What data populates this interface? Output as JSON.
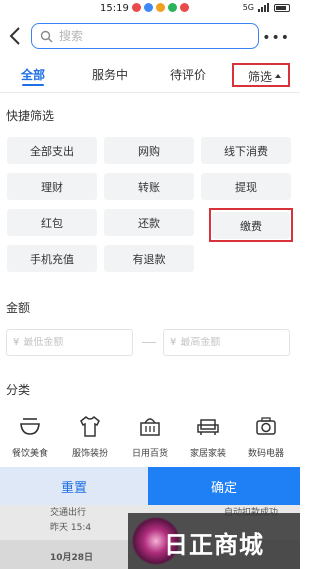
{
  "status_bar": {
    "time": "15:19",
    "signal": "5G"
  },
  "header": {
    "search_placeholder": "搜索",
    "more": "•••"
  },
  "tabs": {
    "all": "全部",
    "in_service": "服务中",
    "to_review": "待评价",
    "filter": "筛选"
  },
  "quick_filter": {
    "title": "快捷筛选",
    "chips": [
      "全部支出",
      "网购",
      "线下消费",
      "理财",
      "转账",
      "提现",
      "红包",
      "还款",
      "缴费",
      "手机充值",
      "有退款"
    ]
  },
  "amount": {
    "title": "金额",
    "currency": "¥",
    "min_placeholder": "最低金额",
    "max_placeholder": "最高金额"
  },
  "category": {
    "title": "分类",
    "items": [
      "餐饮美食",
      "服饰装扮",
      "日用百货",
      "家居家装",
      "数码电器"
    ]
  },
  "background_list": {
    "row1": "交通出行",
    "row2": "昨天  15:4",
    "row3": "自动扣款成功",
    "row4": "10月28日"
  },
  "buttons": {
    "reset": "重置",
    "confirm": "确定"
  },
  "watermark": {
    "text": "日正商城"
  },
  "colors": {
    "accent": "#1f6fe5",
    "highlight_red": "#d9323b",
    "confirm_bg": "#1f80f5"
  }
}
